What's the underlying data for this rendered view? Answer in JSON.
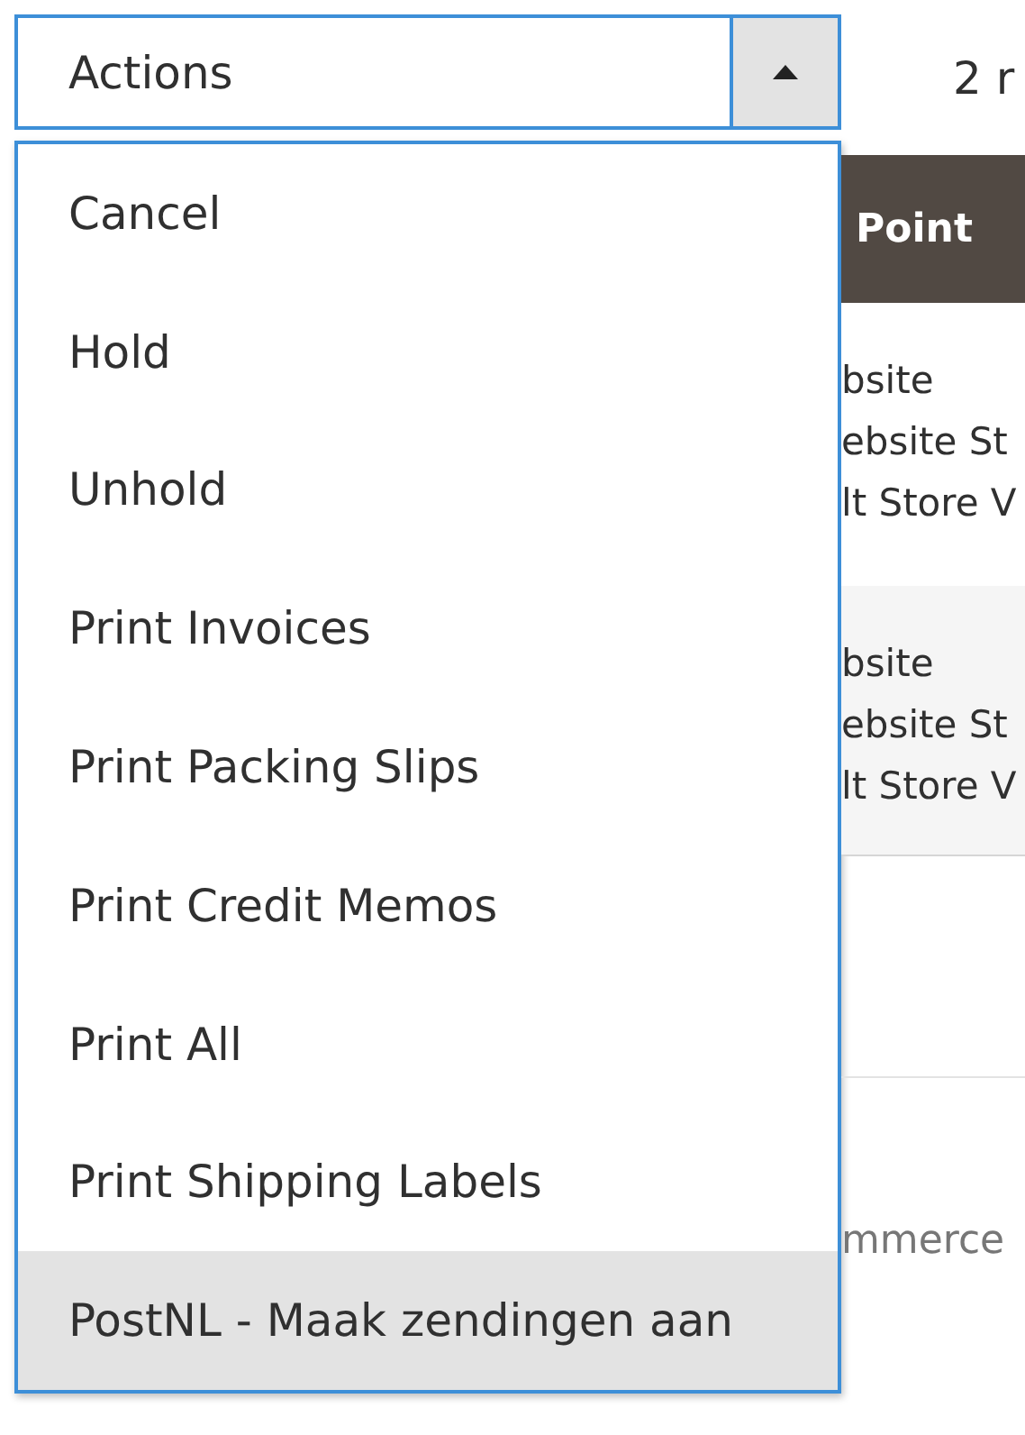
{
  "actions_select": {
    "label": "Actions",
    "expanded": true
  },
  "actions_menu": [
    {
      "label": "Cancel",
      "selected": false
    },
    {
      "label": "Hold",
      "selected": false
    },
    {
      "label": "Unhold",
      "selected": false
    },
    {
      "label": "Print Invoices",
      "selected": false
    },
    {
      "label": "Print Packing Slips",
      "selected": false
    },
    {
      "label": "Print Credit Memos",
      "selected": false
    },
    {
      "label": "Print All",
      "selected": false
    },
    {
      "label": "Print Shipping Labels",
      "selected": false
    },
    {
      "label": "PostNL - Maak zendingen aan",
      "selected": true
    }
  ],
  "records_count": "2 r",
  "table": {
    "column_header": "Point",
    "rows": [
      [
        "bsite",
        "ebsite St",
        "lt Store V"
      ],
      [
        "bsite",
        "ebsite St",
        "lt Store V"
      ]
    ]
  },
  "footer": "mmerce"
}
